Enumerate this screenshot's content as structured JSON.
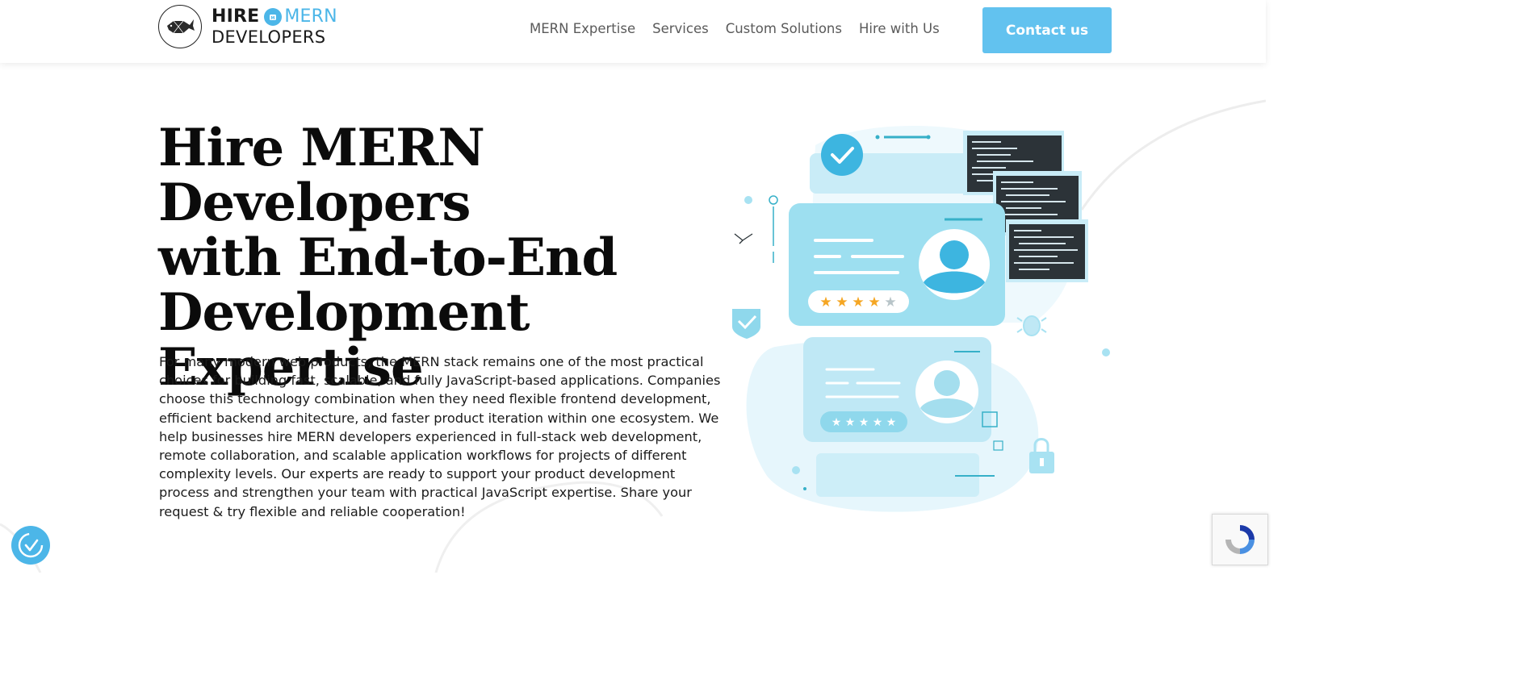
{
  "header": {
    "logo": {
      "word1": "HIRE",
      "word2": "MERN",
      "word3": "DEVELOPERS"
    },
    "nav": [
      "MERN Expertise",
      "Services",
      "Custom Solutions",
      "Hire with Us"
    ],
    "contact_label": "Contact us"
  },
  "hero": {
    "title_lines": [
      "Hire MERN Developers",
      "with End-to-End",
      "Development",
      "Expertise"
    ],
    "description": "For many modern web products, the MERN stack remains one of the most practical choices for building fast, scalable, and fully JavaScript-based applications. Companies choose this technology combination when they need flexible frontend development, efficient backend architecture, and faster product iteration within one ecosystem. We help businesses hire MERN developers experienced in full-stack web development, remote collaboration, and scalable application workflows for projects of different complexity levels. Our experts are ready to support your product development process and strengthen your team with practical JavaScript expertise. Share your request & try flexible and reliable cooperation!"
  },
  "illustration": {
    "card1_rating": 4,
    "card2_rating": 5,
    "max_rating": 5
  },
  "colors": {
    "accent": "#62c2ef",
    "brand": "#4cb6e8",
    "card_light": "#a8e2f2",
    "star": "#f5a623"
  },
  "icons": [
    "whale-logo-icon",
    "accessibility-icon",
    "recaptcha-icon"
  ]
}
